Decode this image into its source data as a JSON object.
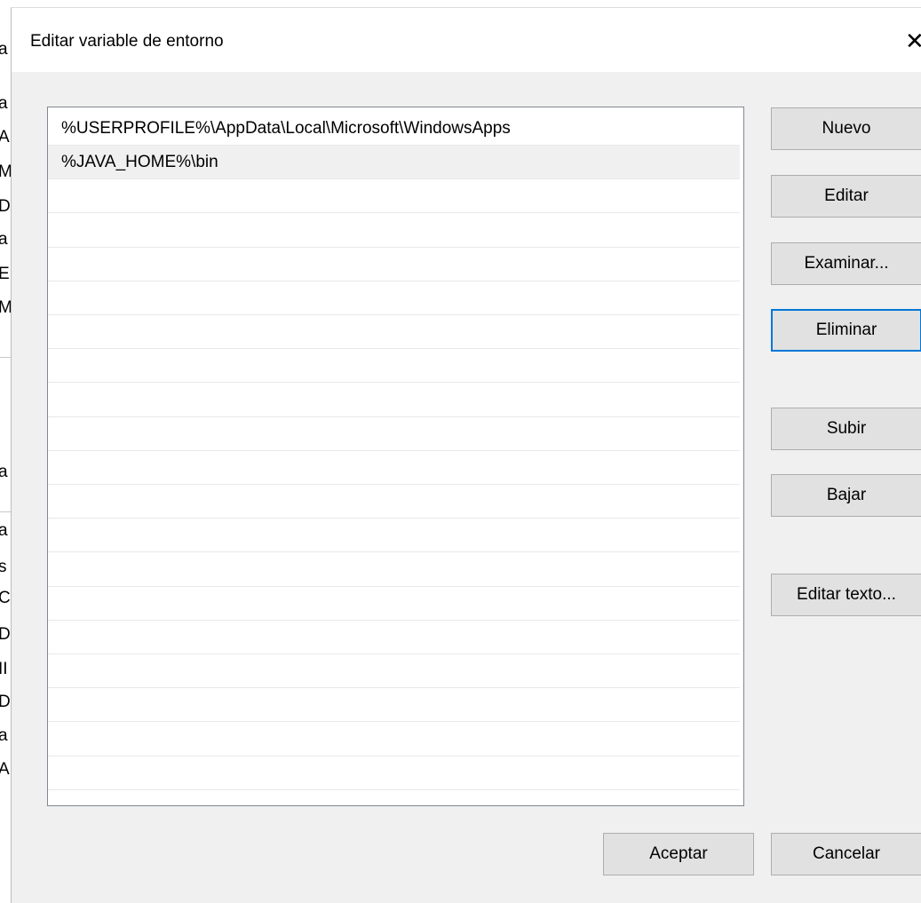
{
  "dialog": {
    "title": "Editar variable de entorno",
    "close_label": "✕"
  },
  "path_list": {
    "items": [
      {
        "text": "%USERPROFILE%\\AppData\\Local\\Microsoft\\WindowsApps",
        "selected": false
      },
      {
        "text": "%JAVA_HOME%\\bin",
        "selected": true
      }
    ],
    "visible_row_count": 20
  },
  "buttons": {
    "nuevo": "Nuevo",
    "editar": "Editar",
    "examinar": "Examinar...",
    "eliminar": "Eliminar",
    "subir": "Subir",
    "bajar": "Bajar",
    "editar_texto": "Editar texto...",
    "aceptar": "Aceptar",
    "cancelar": "Cancelar"
  },
  "background_window": {
    "fragments": [
      "a",
      "a",
      "A",
      "M",
      "Di",
      "a",
      "E",
      "M",
      "a",
      "a",
      "s",
      "C",
      "D",
      "II",
      "D",
      "a",
      "A"
    ]
  },
  "colors": {
    "dialog_bg": "#f0f0f0",
    "titlebar_bg": "#ffffff",
    "list_bg": "#ffffff",
    "button_bg": "#e1e1e1",
    "focus_border": "#0078d7",
    "selected_row": "#f0f0f0"
  }
}
